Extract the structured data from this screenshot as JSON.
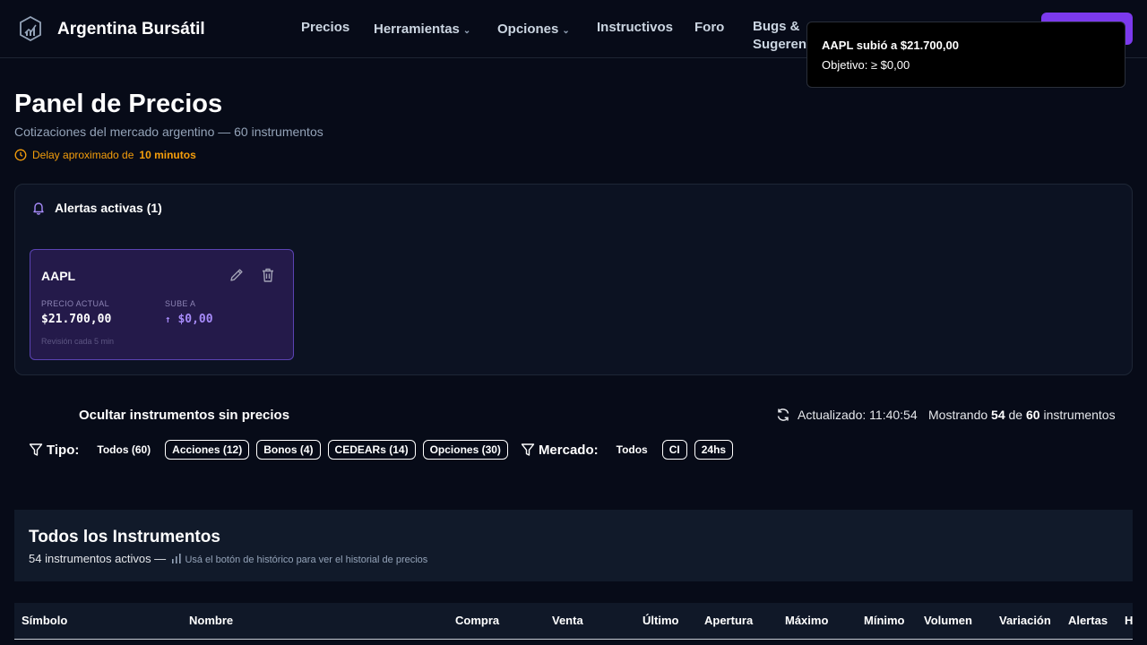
{
  "nav": {
    "brand": "Argentina Bursátil",
    "items": [
      "Precios",
      "Herramientas",
      "Opciones",
      "Instructivos",
      "Foro"
    ],
    "bugs_line1": "Bugs &",
    "bugs_line2": "Sugerenc",
    "chevron": "⌄"
  },
  "toast": {
    "title": "AAPL subió a $21.700,00",
    "subtitle": "Objetivo: ≥ $0,00"
  },
  "page": {
    "title": "Panel de Precios",
    "subtitle": "Cotizaciones del mercado argentino — 60 instrumentos",
    "delay_prefix": "Delay aproximado de",
    "delay_value": "10 minutos"
  },
  "alerts": {
    "header": "Alertas activas (1)",
    "card": {
      "symbol": "AAPL",
      "current_label": "PRECIO ACTUAL",
      "current_value": "$21.700,00",
      "target_label": "SUBE A",
      "target_arrow": "↑",
      "target_value": "$0,00",
      "revision": "Revisión cada 5 min"
    }
  },
  "controls": {
    "hide_label": "Ocultar instrumentos sin precios",
    "updated": "Actualizado: 11:40:54",
    "showing_prefix": "Mostrando",
    "showing_count": "54",
    "showing_mid": "de",
    "showing_total": "60",
    "showing_suffix": "instrumentos"
  },
  "filters": {
    "tipo_label": "Tipo:",
    "tipo": [
      "Todos (60)",
      "Acciones (12)",
      "Bonos (4)",
      "CEDEARs (14)",
      "Opciones (30)"
    ],
    "mercado_label": "Mercado:",
    "mercado": [
      "Todos",
      "CI",
      "24hs"
    ]
  },
  "table": {
    "title": "Todos los Instrumentos",
    "subtitle": "54 instrumentos activos —",
    "hint": "Usá el botón de histórico para ver el historial de precios",
    "columns": [
      "Símbolo",
      "Nombre",
      "Compra",
      "Venta",
      "Último",
      "Apertura",
      "Máximo",
      "Mínimo",
      "Volumen",
      "Variación",
      "Alertas",
      "H"
    ]
  },
  "colors": {
    "background": "#070b18",
    "accent": "#7c3aed",
    "alert_card": "#241a4a",
    "delay": "#f59e0b"
  }
}
